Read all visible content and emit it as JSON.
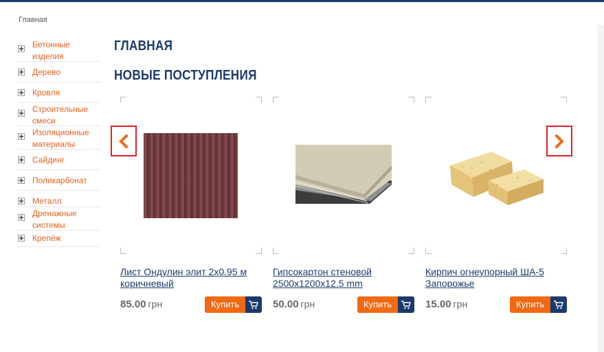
{
  "breadcrumb": {
    "home": "Главная"
  },
  "sidebar": {
    "items": [
      {
        "label": "Бетонные изделия"
      },
      {
        "label": "Дерево"
      },
      {
        "label": "Кровля"
      },
      {
        "label": "Строительные смеси"
      },
      {
        "label": "Изоляционные материалы"
      },
      {
        "label": "Сайдинг"
      },
      {
        "label": "Поликарбонат"
      },
      {
        "label": "Металл"
      },
      {
        "label": "Дренажные системы"
      },
      {
        "label": "Крепёж"
      }
    ]
  },
  "main": {
    "page_title": "ГЛАВНАЯ",
    "section_title": "НОВЫЕ ПОСТУПЛЕНИЯ"
  },
  "products": [
    {
      "name": "Лист Ондулин элит 2x0.95 м коричневый",
      "price": "85.00",
      "currency": "грн",
      "buy_label": "Купить",
      "image": "brown-corrugated-sheet"
    },
    {
      "name": "Гипсокартон стеновой 2500x1200x12.5 mm",
      "price": "50.00",
      "currency": "грн",
      "buy_label": "Купить",
      "image": "drywall-sheets"
    },
    {
      "name": "Кирпич огнеупорный ША-5 Запорожье",
      "price": "15.00",
      "currency": "грн",
      "buy_label": "Купить",
      "image": "fireclay-bricks"
    }
  ],
  "carousel": {
    "prev_icon": "chevron-left-icon",
    "next_icon": "chevron-right-icon"
  },
  "colors": {
    "brand_blue": "#1b3a6b",
    "accent_orange": "#f06a14",
    "link_orange": "#e8601a",
    "arrow_border": "#e02020"
  }
}
